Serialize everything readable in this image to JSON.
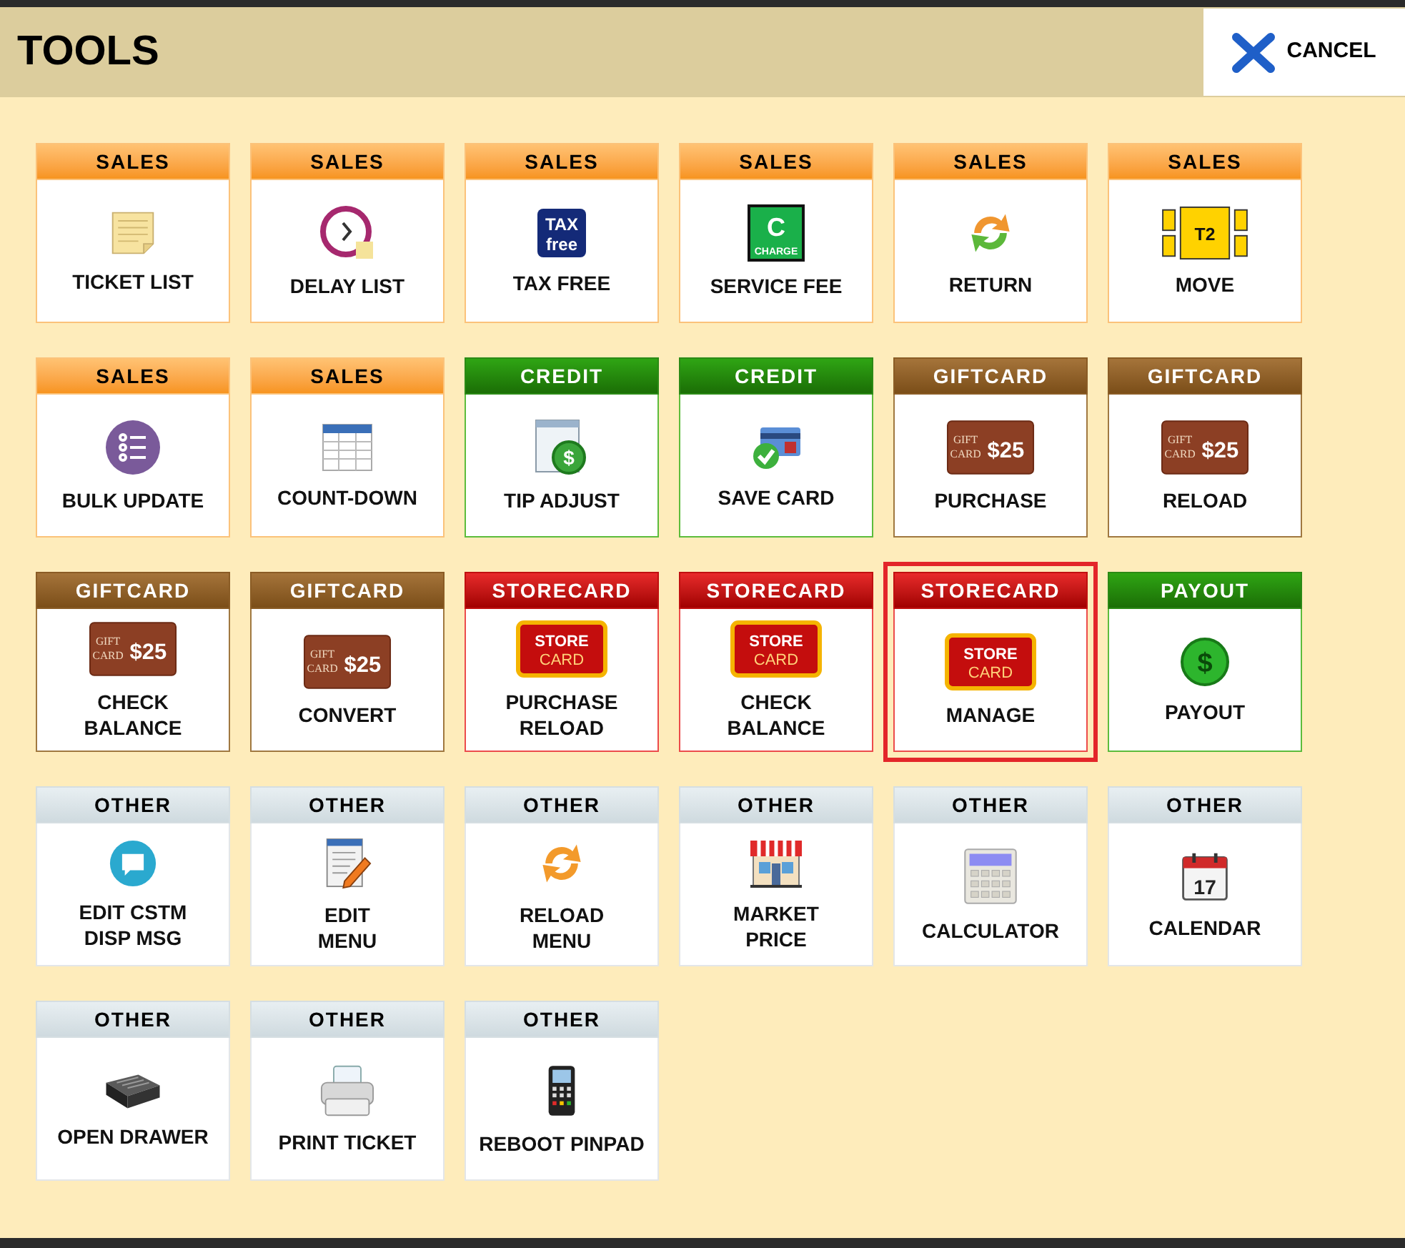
{
  "header": {
    "title": "TOOLS",
    "cancel_button": "CANCEL"
  },
  "tiles": [
    {
      "category": "SALES",
      "kind": "sales",
      "label": [
        "TICKET LIST"
      ],
      "selected": false
    },
    {
      "category": "SALES",
      "kind": "sales",
      "label": [
        "DELAY LIST"
      ],
      "selected": false
    },
    {
      "category": "SALES",
      "kind": "sales",
      "label": [
        "TAX FREE"
      ],
      "icon_text": [
        "TAX",
        "free"
      ],
      "selected": false
    },
    {
      "category": "SALES",
      "kind": "sales",
      "label": [
        "SERVICE FEE"
      ],
      "icon_text": [
        "C",
        "CHARGE"
      ],
      "selected": false
    },
    {
      "category": "SALES",
      "kind": "sales",
      "label": [
        "RETURN"
      ],
      "selected": false
    },
    {
      "category": "SALES",
      "kind": "sales",
      "label": [
        "MOVE"
      ],
      "icon_text": [
        "T2"
      ],
      "selected": false
    },
    {
      "category": "SALES",
      "kind": "sales",
      "label": [
        "BULK UPDATE"
      ],
      "selected": false
    },
    {
      "category": "SALES",
      "kind": "sales",
      "label": [
        "COUNT-DOWN"
      ],
      "selected": false
    },
    {
      "category": "CREDIT",
      "kind": "credit",
      "label": [
        "TIP ADJUST"
      ],
      "icon_text": [
        "$"
      ],
      "selected": false
    },
    {
      "category": "CREDIT",
      "kind": "credit",
      "label": [
        "SAVE CARD"
      ],
      "selected": false
    },
    {
      "category": "GIFTCARD",
      "kind": "giftcard",
      "label": [
        "PURCHASE"
      ],
      "icon_text": [
        "GIFT",
        "CARD",
        "$25"
      ],
      "selected": false
    },
    {
      "category": "GIFTCARD",
      "kind": "giftcard",
      "label": [
        "RELOAD"
      ],
      "icon_text": [
        "GIFT",
        "CARD",
        "$25"
      ],
      "selected": false
    },
    {
      "category": "GIFTCARD",
      "kind": "giftcard",
      "label": [
        "CHECK",
        "BALANCE"
      ],
      "icon_text": [
        "GIFT",
        "CARD",
        "$25"
      ],
      "selected": false
    },
    {
      "category": "GIFTCARD",
      "kind": "giftcard",
      "label": [
        "CONVERT"
      ],
      "icon_text": [
        "GIFT",
        "CARD",
        "$25"
      ],
      "selected": false
    },
    {
      "category": "STORECARD",
      "kind": "storecard",
      "label": [
        "PURCHASE",
        "RELOAD"
      ],
      "icon_text": [
        "STORE",
        "CARD"
      ],
      "selected": false
    },
    {
      "category": "STORECARD",
      "kind": "storecard",
      "label": [
        "CHECK",
        "BALANCE"
      ],
      "icon_text": [
        "STORE",
        "CARD"
      ],
      "selected": false
    },
    {
      "category": "STORECARD",
      "kind": "storecard",
      "label": [
        "MANAGE"
      ],
      "icon_text": [
        "STORE",
        "CARD"
      ],
      "selected": true
    },
    {
      "category": "PAYOUT",
      "kind": "payout",
      "label": [
        "PAYOUT"
      ],
      "icon_text": [
        "$"
      ],
      "selected": false
    },
    {
      "category": "OTHER",
      "kind": "other",
      "label": [
        "EDIT CSTM",
        "DISP MSG"
      ],
      "selected": false
    },
    {
      "category": "OTHER",
      "kind": "other",
      "label": [
        "EDIT",
        "MENU"
      ],
      "selected": false
    },
    {
      "category": "OTHER",
      "kind": "other",
      "label": [
        "RELOAD",
        "MENU"
      ],
      "selected": false
    },
    {
      "category": "OTHER",
      "kind": "other",
      "label": [
        "MARKET",
        "PRICE"
      ],
      "selected": false
    },
    {
      "category": "OTHER",
      "kind": "other",
      "label": [
        "CALCULATOR"
      ],
      "selected": false
    },
    {
      "category": "OTHER",
      "kind": "other",
      "label": [
        "CALENDAR"
      ],
      "icon_text": [
        "17"
      ],
      "selected": false
    },
    {
      "category": "OTHER",
      "kind": "other",
      "label": [
        "OPEN DRAWER"
      ],
      "selected": false
    },
    {
      "category": "OTHER",
      "kind": "other",
      "label": [
        "PRINT TICKET"
      ],
      "selected": false
    },
    {
      "category": "OTHER",
      "kind": "other",
      "label": [
        "REBOOT PINPAD"
      ],
      "selected": false
    }
  ]
}
